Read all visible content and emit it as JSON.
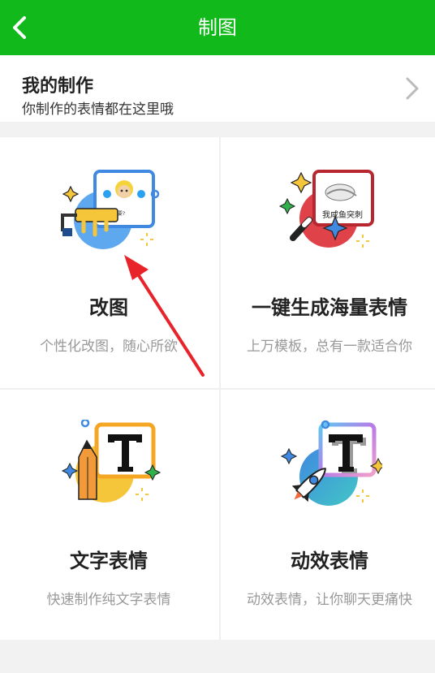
{
  "header": {
    "title": "制图",
    "back_icon": "back-arrow-icon"
  },
  "my_creations": {
    "title": "我的制作",
    "subtitle": "你制作的表情都在这里哦",
    "chevron_icon": "chevron-right-icon"
  },
  "tools": [
    {
      "name": "改图",
      "desc": "个性化改图，随心所欲",
      "icon": "paint-roller-meme-icon"
    },
    {
      "name": "一键生成海量表情",
      "desc": "上万模板，总有一款适合你",
      "icon": "magic-wand-template-icon"
    },
    {
      "name": "文字表情",
      "desc": "快速制作纯文字表情",
      "icon": "pencil-text-icon"
    },
    {
      "name": "动效表情",
      "desc": "动效表情，让你聊天更痛快",
      "icon": "rocket-text-icon"
    }
  ],
  "thumbnails": {
    "edit_meme_caption": "不要?",
    "template_meme_caption": "我咸鱼突刺"
  },
  "colors": {
    "primary_green": "#12b91a",
    "annotation_arrow": "#e8242a"
  }
}
